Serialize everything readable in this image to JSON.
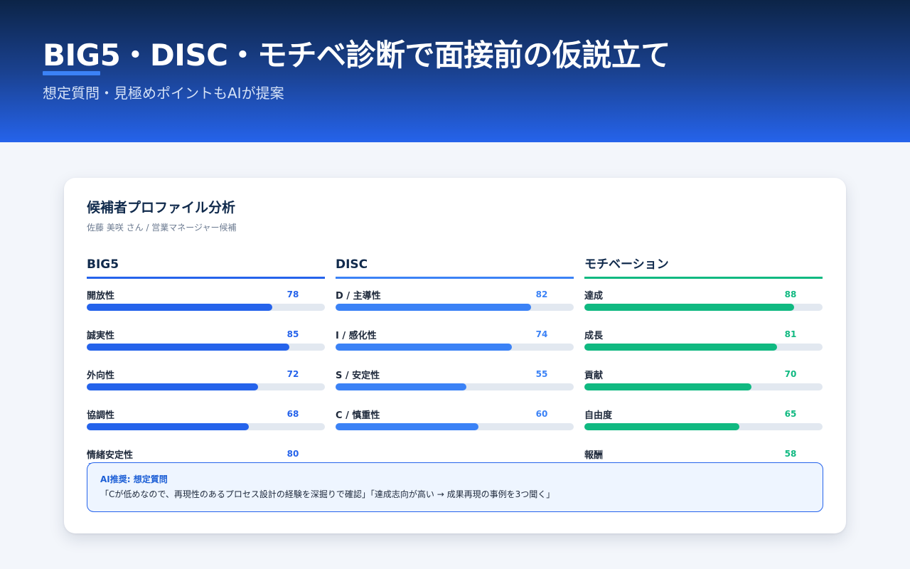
{
  "hero": {
    "title": "BIG5・DISC・モチベ診断で面接前の仮説立て",
    "subtitle": "想定質問・見極めポイントもAIが提案"
  },
  "card": {
    "title": "候補者プロファイル分析",
    "subtitle": "佐藤 美咲 さん / 営業マネージャー候補"
  },
  "colors": {
    "big5": "#2563eb",
    "disc": "#3b82f6",
    "motivation": "#10b981",
    "hero_top": "#0c2447",
    "hero_bottom": "#2563eb"
  },
  "columns": [
    {
      "key": "big5",
      "title": "BIG5",
      "items": [
        {
          "label": "開放性",
          "value": 78
        },
        {
          "label": "誠実性",
          "value": 85
        },
        {
          "label": "外向性",
          "value": 72
        },
        {
          "label": "協調性",
          "value": 68
        },
        {
          "label": "情緒安定性",
          "value": 80
        }
      ]
    },
    {
      "key": "disc",
      "title": "DISC",
      "items": [
        {
          "label": "D / 主導性",
          "value": 82
        },
        {
          "label": "I / 感化性",
          "value": 74
        },
        {
          "label": "S / 安定性",
          "value": 55
        },
        {
          "label": "C / 慎重性",
          "value": 60
        }
      ]
    },
    {
      "key": "motivation",
      "title": "モチベーション",
      "items": [
        {
          "label": "達成",
          "value": 88
        },
        {
          "label": "成長",
          "value": 81
        },
        {
          "label": "貢献",
          "value": 70
        },
        {
          "label": "自由度",
          "value": 65
        },
        {
          "label": "報酬",
          "value": 58
        }
      ]
    }
  ],
  "ai": {
    "title": "AI推奨: 想定質問",
    "text": "「Cが低めなので、再現性のあるプロセス設計の経験を深掘りで確認」「達成志向が高い → 成果再現の事例を3つ聞く」"
  }
}
